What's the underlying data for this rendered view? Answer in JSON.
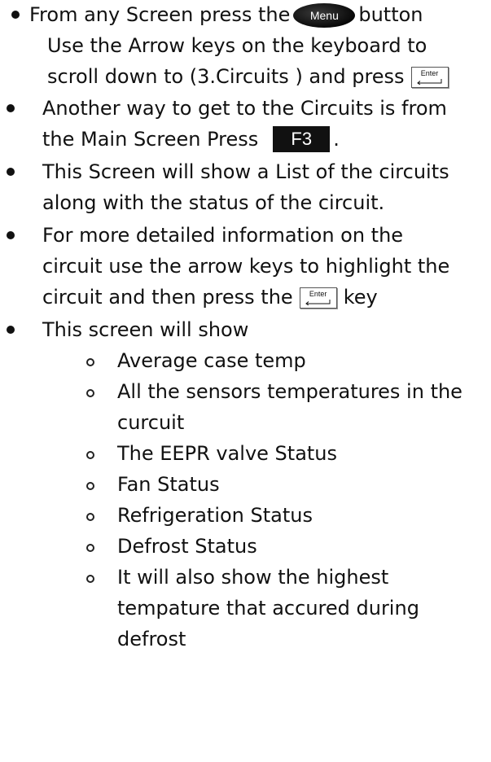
{
  "items": {
    "b1": {
      "line1_before": "From any Screen press the",
      "line1_after": "button",
      "line2": "Use the Arrow keys on the keyboard to",
      "line3": "scroll down to (3.Circuits ) and press"
    },
    "b2": {
      "line1": "Another way to get to the Circuits is from",
      "line2_before": "the Main Screen Press",
      "line2_after": "."
    },
    "b3": {
      "line1": "This Screen will show a List of the circuits",
      "line2": "along with the status of the circuit."
    },
    "b4": {
      "line1": "For more detailed information on the",
      "line2": "circuit  use the arrow keys to highlight the",
      "line3_before": "circuit and then press the",
      "line3_after": "key"
    },
    "b5": {
      "line1": "This screen will show"
    },
    "sub": {
      "s1": "Average case temp",
      "s2_line1": "All the sensors temperatures in the",
      "s2_line2": "curcuit",
      "s3": "The EEPR valve Status",
      "s4": "Fan Status",
      "s5": "Refrigeration Status",
      "s6": "Defrost Status",
      "s7_line1": "It will also show the highest",
      "s7_line2": "tempature that accured during",
      "s7_line3": "defrost"
    }
  },
  "keys": {
    "menu_label": "Menu",
    "enter_label": "Enter",
    "f3_label": "F3"
  }
}
